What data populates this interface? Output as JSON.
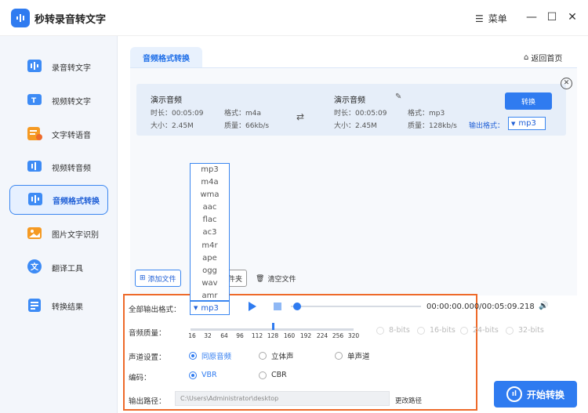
{
  "app": {
    "title": "秒转录音转文字",
    "menu_label": "菜单"
  },
  "sidebar": {
    "items": [
      {
        "label": "录音转文字",
        "icon": "audio-to-text-icon"
      },
      {
        "label": "视频转文字",
        "icon": "video-to-text-icon"
      },
      {
        "label": "文字转语音",
        "icon": "text-to-speech-icon"
      },
      {
        "label": "视频转音频",
        "icon": "video-to-audio-icon"
      },
      {
        "label": "音频格式转换",
        "icon": "audio-format-icon"
      },
      {
        "label": "图片文字识别",
        "icon": "image-ocr-icon"
      },
      {
        "label": "翻译工具",
        "icon": "translate-icon"
      },
      {
        "label": "转换结果",
        "icon": "results-icon"
      }
    ],
    "active_index": 4
  },
  "main": {
    "tab_label": "音频格式转换",
    "home_label": "返回首页",
    "source_file": {
      "name": "演示音频",
      "duration": "时长：00:05:09",
      "format": "格式：m4a",
      "size": "大小：2.45M",
      "quality": "质量：66kb/s"
    },
    "target_file": {
      "name": "演示音频",
      "duration": "时长：00:05:09",
      "format": "格式：mp3",
      "size": "大小：2.45M",
      "quality": "质量：128kb/s"
    },
    "convert_label": "转换",
    "output_format_label": "输出格式：",
    "output_format_value": "mp3",
    "add_file_label": "添加文件",
    "add_folder_label_visible": "件夹",
    "clear_label": "清空文件"
  },
  "dropdown": {
    "options": [
      "mp3",
      "m4a",
      "wma",
      "aac",
      "flac",
      "ac3",
      "m4r",
      "ape",
      "ogg",
      "wav",
      "amr"
    ]
  },
  "settings": {
    "all_format_label": "全部输出格式：",
    "all_format_value": "mp3",
    "time_display": "00:00:00.000/00:05:09.218",
    "quality_label": "音频质量：",
    "quality_ticks": [
      "16",
      "32",
      "64",
      "96",
      "112",
      "128",
      "160",
      "192",
      "224",
      "256",
      "320"
    ],
    "quality_selected": "128",
    "bit_options": [
      "8-bits",
      "16-bits",
      "24-bits",
      "32-bits"
    ],
    "channel_label": "声道设置：",
    "channel_options": [
      "同原音频",
      "立体声",
      "单声道"
    ],
    "channel_selected": 0,
    "encoding_label": "编码：",
    "encoding_options": [
      "VBR",
      "CBR"
    ],
    "encoding_selected": 0,
    "output_path_label": "输出路径：",
    "output_path_value": "C:\\Users\\Administrator\\desktop",
    "change_path_label": "更改路径"
  },
  "start_button_label": "开始转换",
  "colors": {
    "accent": "#2f7bf0",
    "highlight_border": "#ee6a2a",
    "sidebar_bg": "#f3f6fb"
  }
}
